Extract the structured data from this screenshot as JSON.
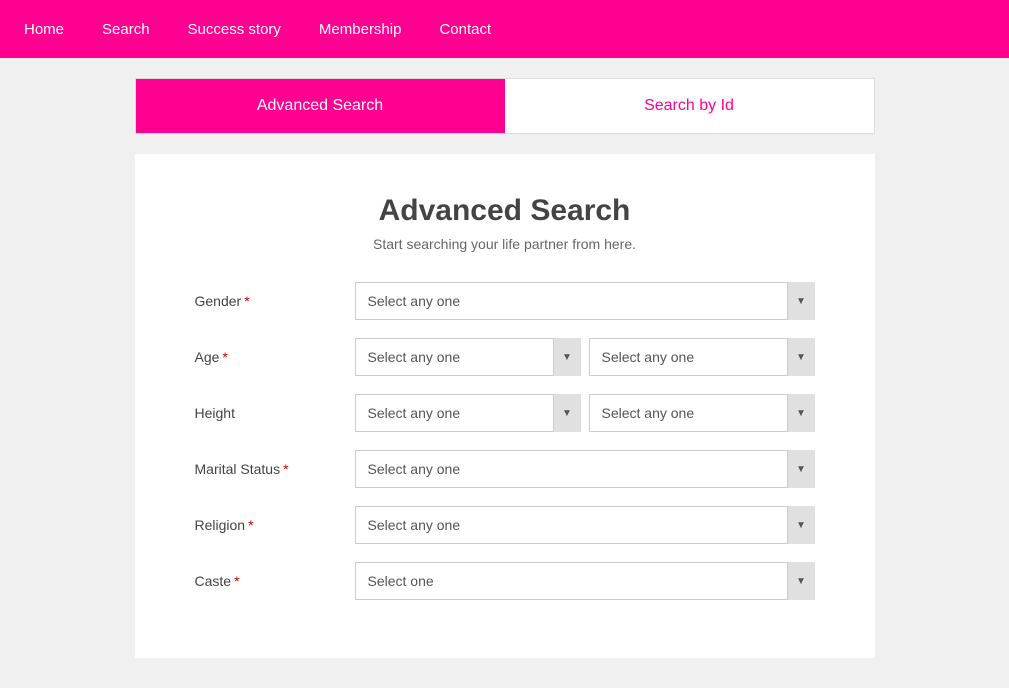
{
  "navbar": {
    "links": [
      {
        "label": "Home",
        "href": "#"
      },
      {
        "label": "Search",
        "href": "#"
      },
      {
        "label": "Success story",
        "href": "#"
      },
      {
        "label": "Membership",
        "href": "#"
      },
      {
        "label": "Contact",
        "href": "#"
      }
    ]
  },
  "tabs": [
    {
      "id": "advanced-search",
      "label": "Advanced Search",
      "active": true
    },
    {
      "id": "search-by-id",
      "label": "Search by Id",
      "active": false
    }
  ],
  "form": {
    "title": "Advanced Search",
    "subtitle": "Start searching your life partner from here.",
    "fields": [
      {
        "id": "gender",
        "label": "Gender",
        "required": true,
        "type": "single",
        "placeholder": "Select any one"
      },
      {
        "id": "age",
        "label": "Age",
        "required": true,
        "type": "double",
        "placeholder1": "Select any one",
        "placeholder2": "Select any one"
      },
      {
        "id": "height",
        "label": "Height",
        "required": false,
        "type": "double",
        "placeholder1": "Select any one",
        "placeholder2": "Select any one"
      },
      {
        "id": "marital-status",
        "label": "Marital Status",
        "required": true,
        "type": "single",
        "placeholder": "Select any one"
      },
      {
        "id": "religion",
        "label": "Religion",
        "required": true,
        "type": "single",
        "placeholder": "Select any one"
      },
      {
        "id": "caste",
        "label": "Caste",
        "required": true,
        "type": "single",
        "placeholder": "Select one"
      }
    ]
  },
  "colors": {
    "primary": "#ff0090",
    "navbar_bg": "#ff0090",
    "tab_active_bg": "#ff0090",
    "tab_active_text": "#ffffff",
    "tab_inactive_text": "#ff0090"
  }
}
